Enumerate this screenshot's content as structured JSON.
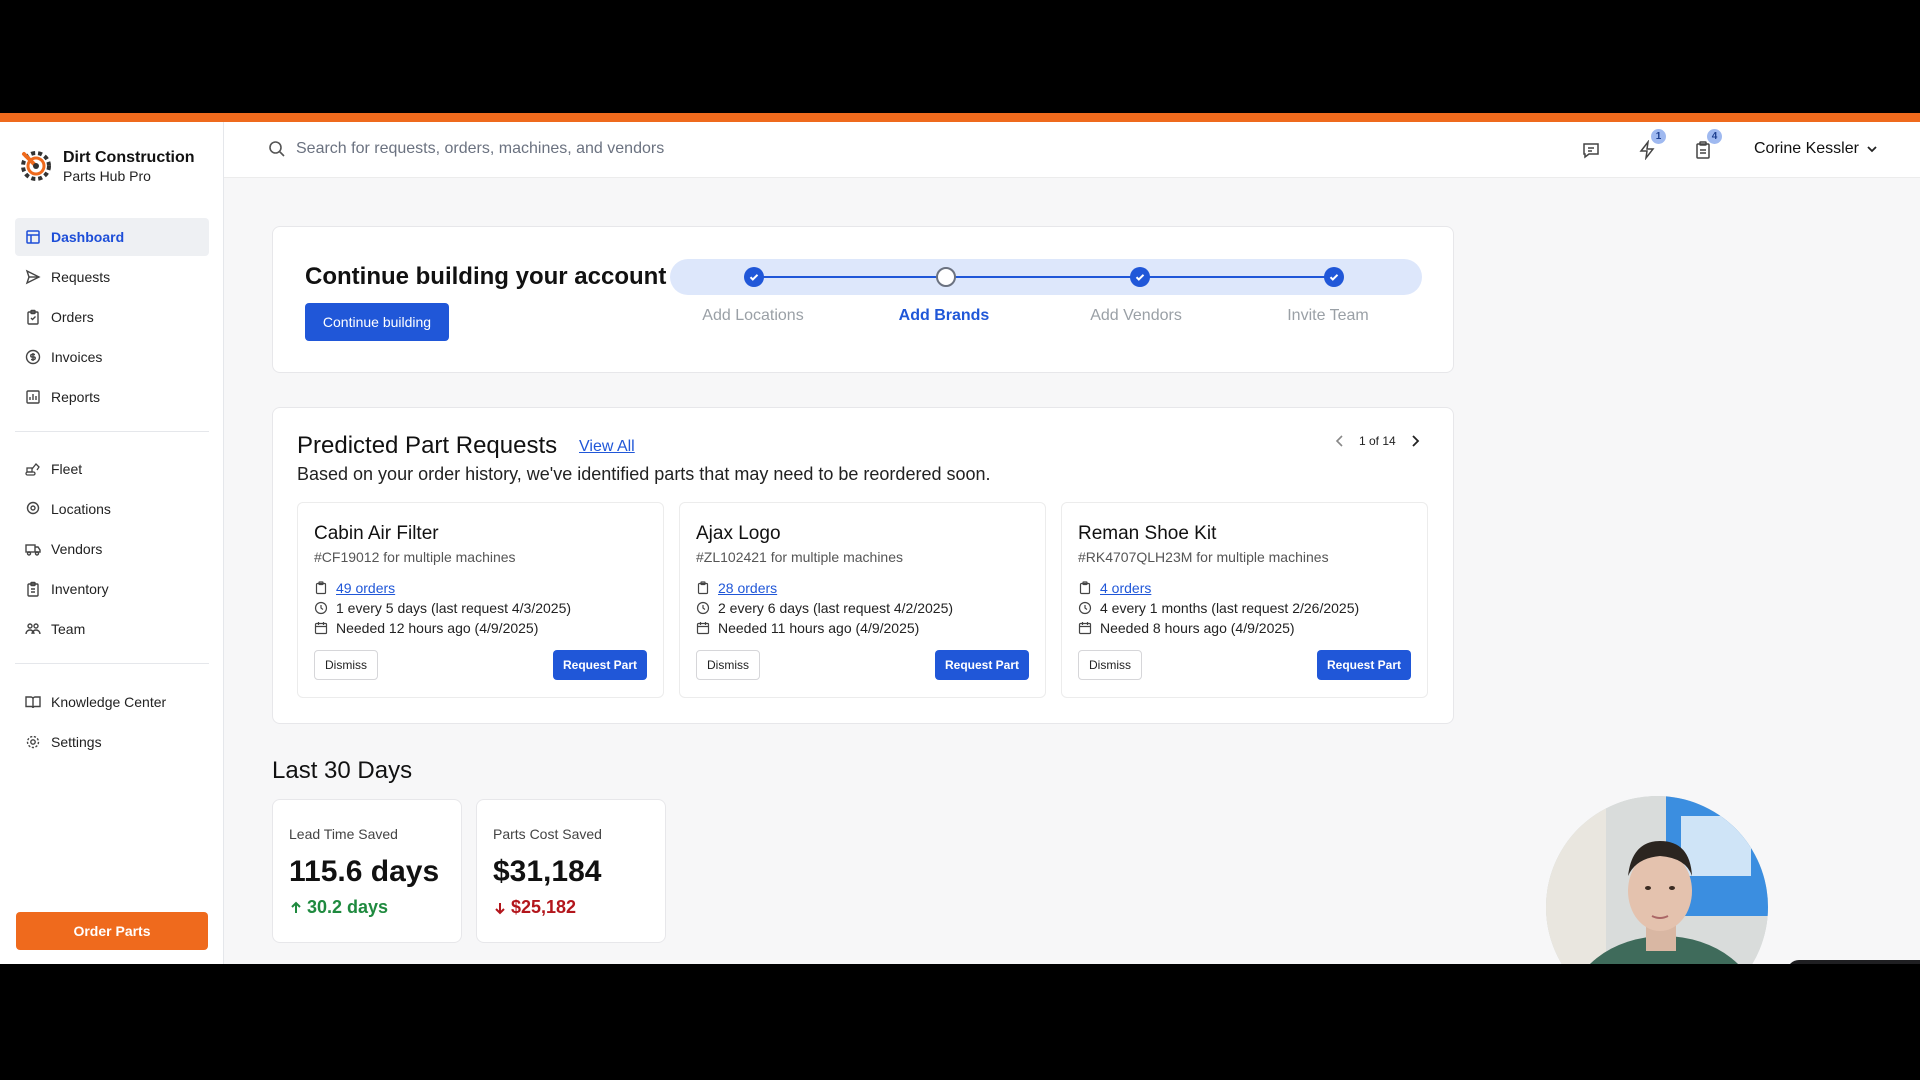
{
  "brand": {
    "name": "Dirt Construction",
    "subtitle": "Parts Hub Pro"
  },
  "search": {
    "placeholder": "Search for requests, orders, machines, and vendors"
  },
  "header": {
    "icons": [
      {
        "name": "chat-icon",
        "badge": ""
      },
      {
        "name": "lightning-icon",
        "badge": "1"
      },
      {
        "name": "clipboard-icon",
        "badge": "4"
      }
    ],
    "user_name": "Corine Kessler"
  },
  "sidebar": {
    "group1": [
      {
        "label": "Dashboard",
        "icon": "dashboard-icon",
        "active": true
      },
      {
        "label": "Requests",
        "icon": "send-icon"
      },
      {
        "label": "Orders",
        "icon": "clipboard-icon"
      },
      {
        "label": "Invoices",
        "icon": "dollar-icon"
      },
      {
        "label": "Reports",
        "icon": "bar-chart-icon"
      }
    ],
    "group2": [
      {
        "label": "Fleet",
        "icon": "excavator-icon"
      },
      {
        "label": "Locations",
        "icon": "map-pin-icon"
      },
      {
        "label": "Vendors",
        "icon": "truck-icon"
      },
      {
        "label": "Inventory",
        "icon": "clipboard-list-icon"
      },
      {
        "label": "Team",
        "icon": "users-icon"
      }
    ],
    "group3": [
      {
        "label": "Knowledge Center",
        "icon": "book-icon"
      },
      {
        "label": "Settings",
        "icon": "gear-icon"
      }
    ],
    "order_button": "Order Parts"
  },
  "onboarding": {
    "title": "Continue building your account",
    "button": "Continue building",
    "steps": [
      {
        "label": "Add Locations",
        "done": true
      },
      {
        "label": "Add Brands",
        "done": false,
        "current": true
      },
      {
        "label": "Add Vendors",
        "done": true
      },
      {
        "label": "Invite Team",
        "done": true
      }
    ]
  },
  "predicted": {
    "title": "Predicted Part Requests",
    "view_all": "View All",
    "description": "Based on your order history, we've identified parts that may need to be reordered soon.",
    "pager": "1 of 14",
    "dismiss_label": "Dismiss",
    "request_label": "Request Part",
    "cards": [
      {
        "title": "Cabin Air Filter",
        "sku": "#CF19012 for multiple machines",
        "orders": "49 orders",
        "frequency": "1 every 5 days (last request 4/3/2025)",
        "needed": "Needed 12 hours ago (4/9/2025)"
      },
      {
        "title": "Ajax Logo",
        "sku": "#ZL102421 for multiple machines",
        "orders": "28 orders",
        "frequency": "2 every 6 days (last request 4/2/2025)",
        "needed": "Needed 11 hours ago (4/9/2025)"
      },
      {
        "title": "Reman Shoe Kit",
        "sku": "#RK4707QLH23M for multiple machines",
        "orders": "4 orders",
        "frequency": "4 every 1 months (last request 2/26/2025)",
        "needed": "Needed 8 hours ago (4/9/2025)"
      }
    ]
  },
  "last30": {
    "title": "Last 30 Days",
    "stats": [
      {
        "label": "Lead Time Saved",
        "value": "115.6 days",
        "delta": "30.2 days",
        "direction": "up",
        "color": "#1f8a3f"
      },
      {
        "label": "Parts Cost Saved",
        "value": "$31,184",
        "delta": "$25,182",
        "direction": "down",
        "color": "#b3161c"
      }
    ]
  },
  "colors": {
    "accent": "#ef6a1d",
    "primary": "#2057d8",
    "active_bg": "#eef0f3"
  }
}
